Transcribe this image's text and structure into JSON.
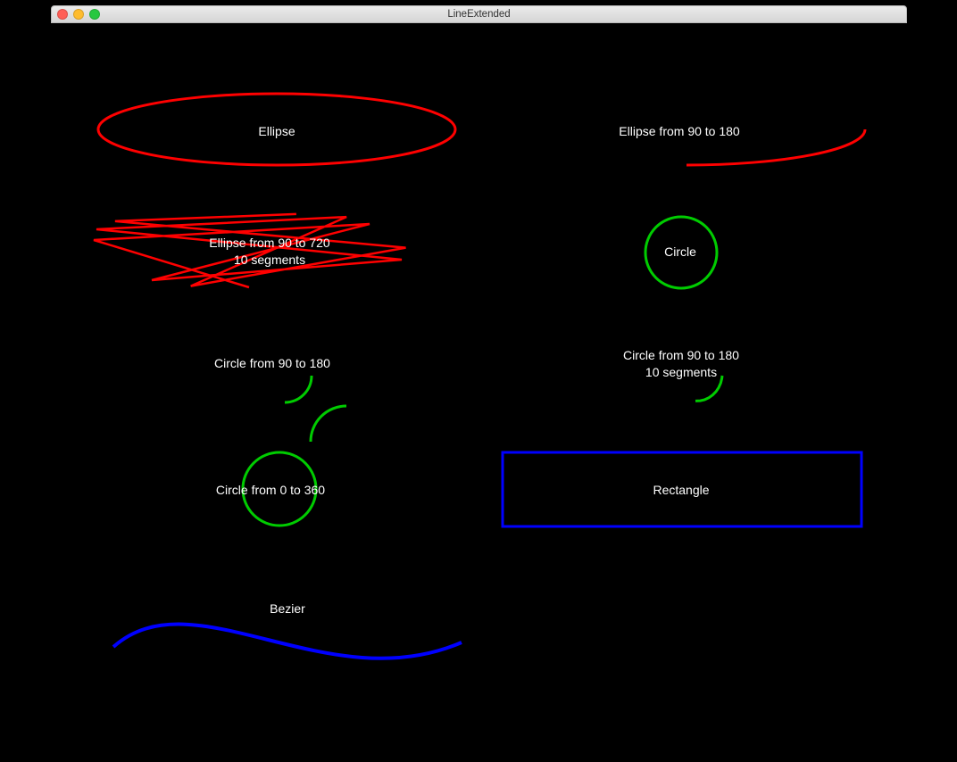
{
  "window": {
    "title": "LineExtended"
  },
  "colors": {
    "red": "#ff0000",
    "green": "#00cc00",
    "blue": "#0000ff"
  },
  "shapes": {
    "ellipse": {
      "label": "Ellipse"
    },
    "ellipse_arc": {
      "label": "Ellipse from 90 to 180"
    },
    "ellipse_seg": {
      "label": "Ellipse from 90 to 720\n10 segments"
    },
    "circle": {
      "label": "Circle"
    },
    "circle_arc": {
      "label": "Circle from 90 to 180"
    },
    "circle_arc_seg": {
      "label": "Circle from 90 to 180\n10 segments"
    },
    "circle_full": {
      "label": "Circle from 0 to 360"
    },
    "rectangle": {
      "label": "Rectangle"
    },
    "bezier": {
      "label": "Bezier"
    }
  }
}
